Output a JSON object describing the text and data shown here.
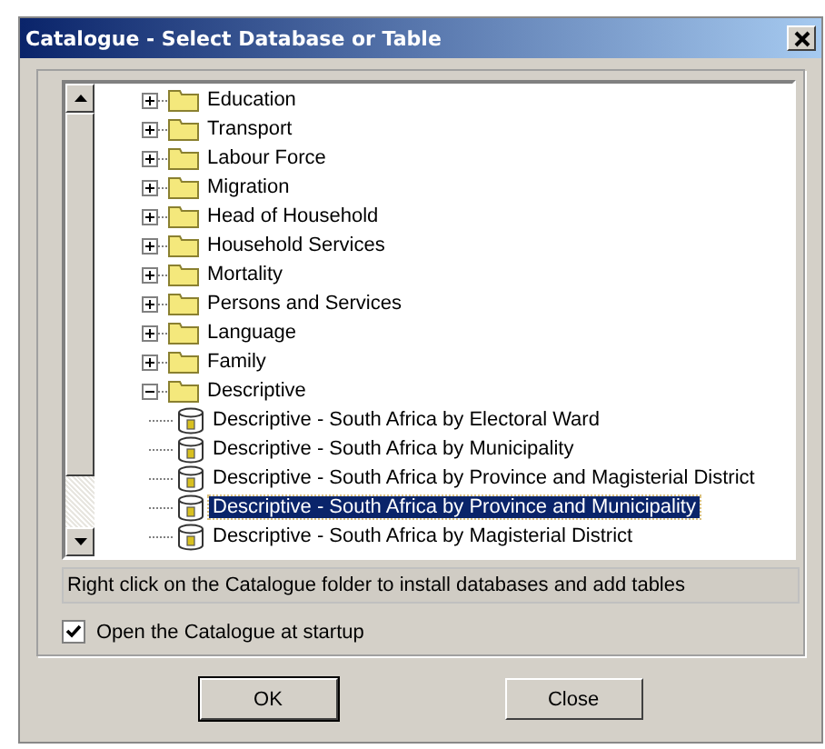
{
  "window": {
    "title": "Catalogue - Select Database or Table"
  },
  "tree": {
    "items": [
      {
        "label": "Education",
        "kind": "folder",
        "expanded": false,
        "selected": false
      },
      {
        "label": "Transport",
        "kind": "folder",
        "expanded": false,
        "selected": false
      },
      {
        "label": "Labour Force",
        "kind": "folder",
        "expanded": false,
        "selected": false
      },
      {
        "label": "Migration",
        "kind": "folder",
        "expanded": false,
        "selected": false
      },
      {
        "label": "Head of Household",
        "kind": "folder",
        "expanded": false,
        "selected": false
      },
      {
        "label": "Household Services",
        "kind": "folder",
        "expanded": false,
        "selected": false
      },
      {
        "label": "Mortality",
        "kind": "folder",
        "expanded": false,
        "selected": false
      },
      {
        "label": "Persons and Services",
        "kind": "folder",
        "expanded": false,
        "selected": false
      },
      {
        "label": "Language",
        "kind": "folder",
        "expanded": false,
        "selected": false
      },
      {
        "label": "Family",
        "kind": "folder",
        "expanded": false,
        "selected": false
      },
      {
        "label": "Descriptive",
        "kind": "folder",
        "expanded": true,
        "selected": false,
        "children": [
          {
            "label": "Descriptive - South Africa by Electoral Ward",
            "kind": "table",
            "selected": false
          },
          {
            "label": "Descriptive - South Africa by Municipality",
            "kind": "table",
            "selected": false
          },
          {
            "label": "Descriptive - South Africa by Province and Magisterial District",
            "kind": "table",
            "selected": false
          },
          {
            "label": "Descriptive - South Africa by Province and Municipality",
            "kind": "table",
            "selected": true
          },
          {
            "label": "Descriptive - South Africa by Magisterial District",
            "kind": "table",
            "selected": false
          }
        ]
      }
    ]
  },
  "status": "Right click on the Catalogue folder to install databases and add tables",
  "startup_checkbox": {
    "label": "Open the Catalogue at startup",
    "checked": true
  },
  "buttons": [
    {
      "label": "OK",
      "default": true
    },
    {
      "label": "Close",
      "default": false
    }
  ]
}
